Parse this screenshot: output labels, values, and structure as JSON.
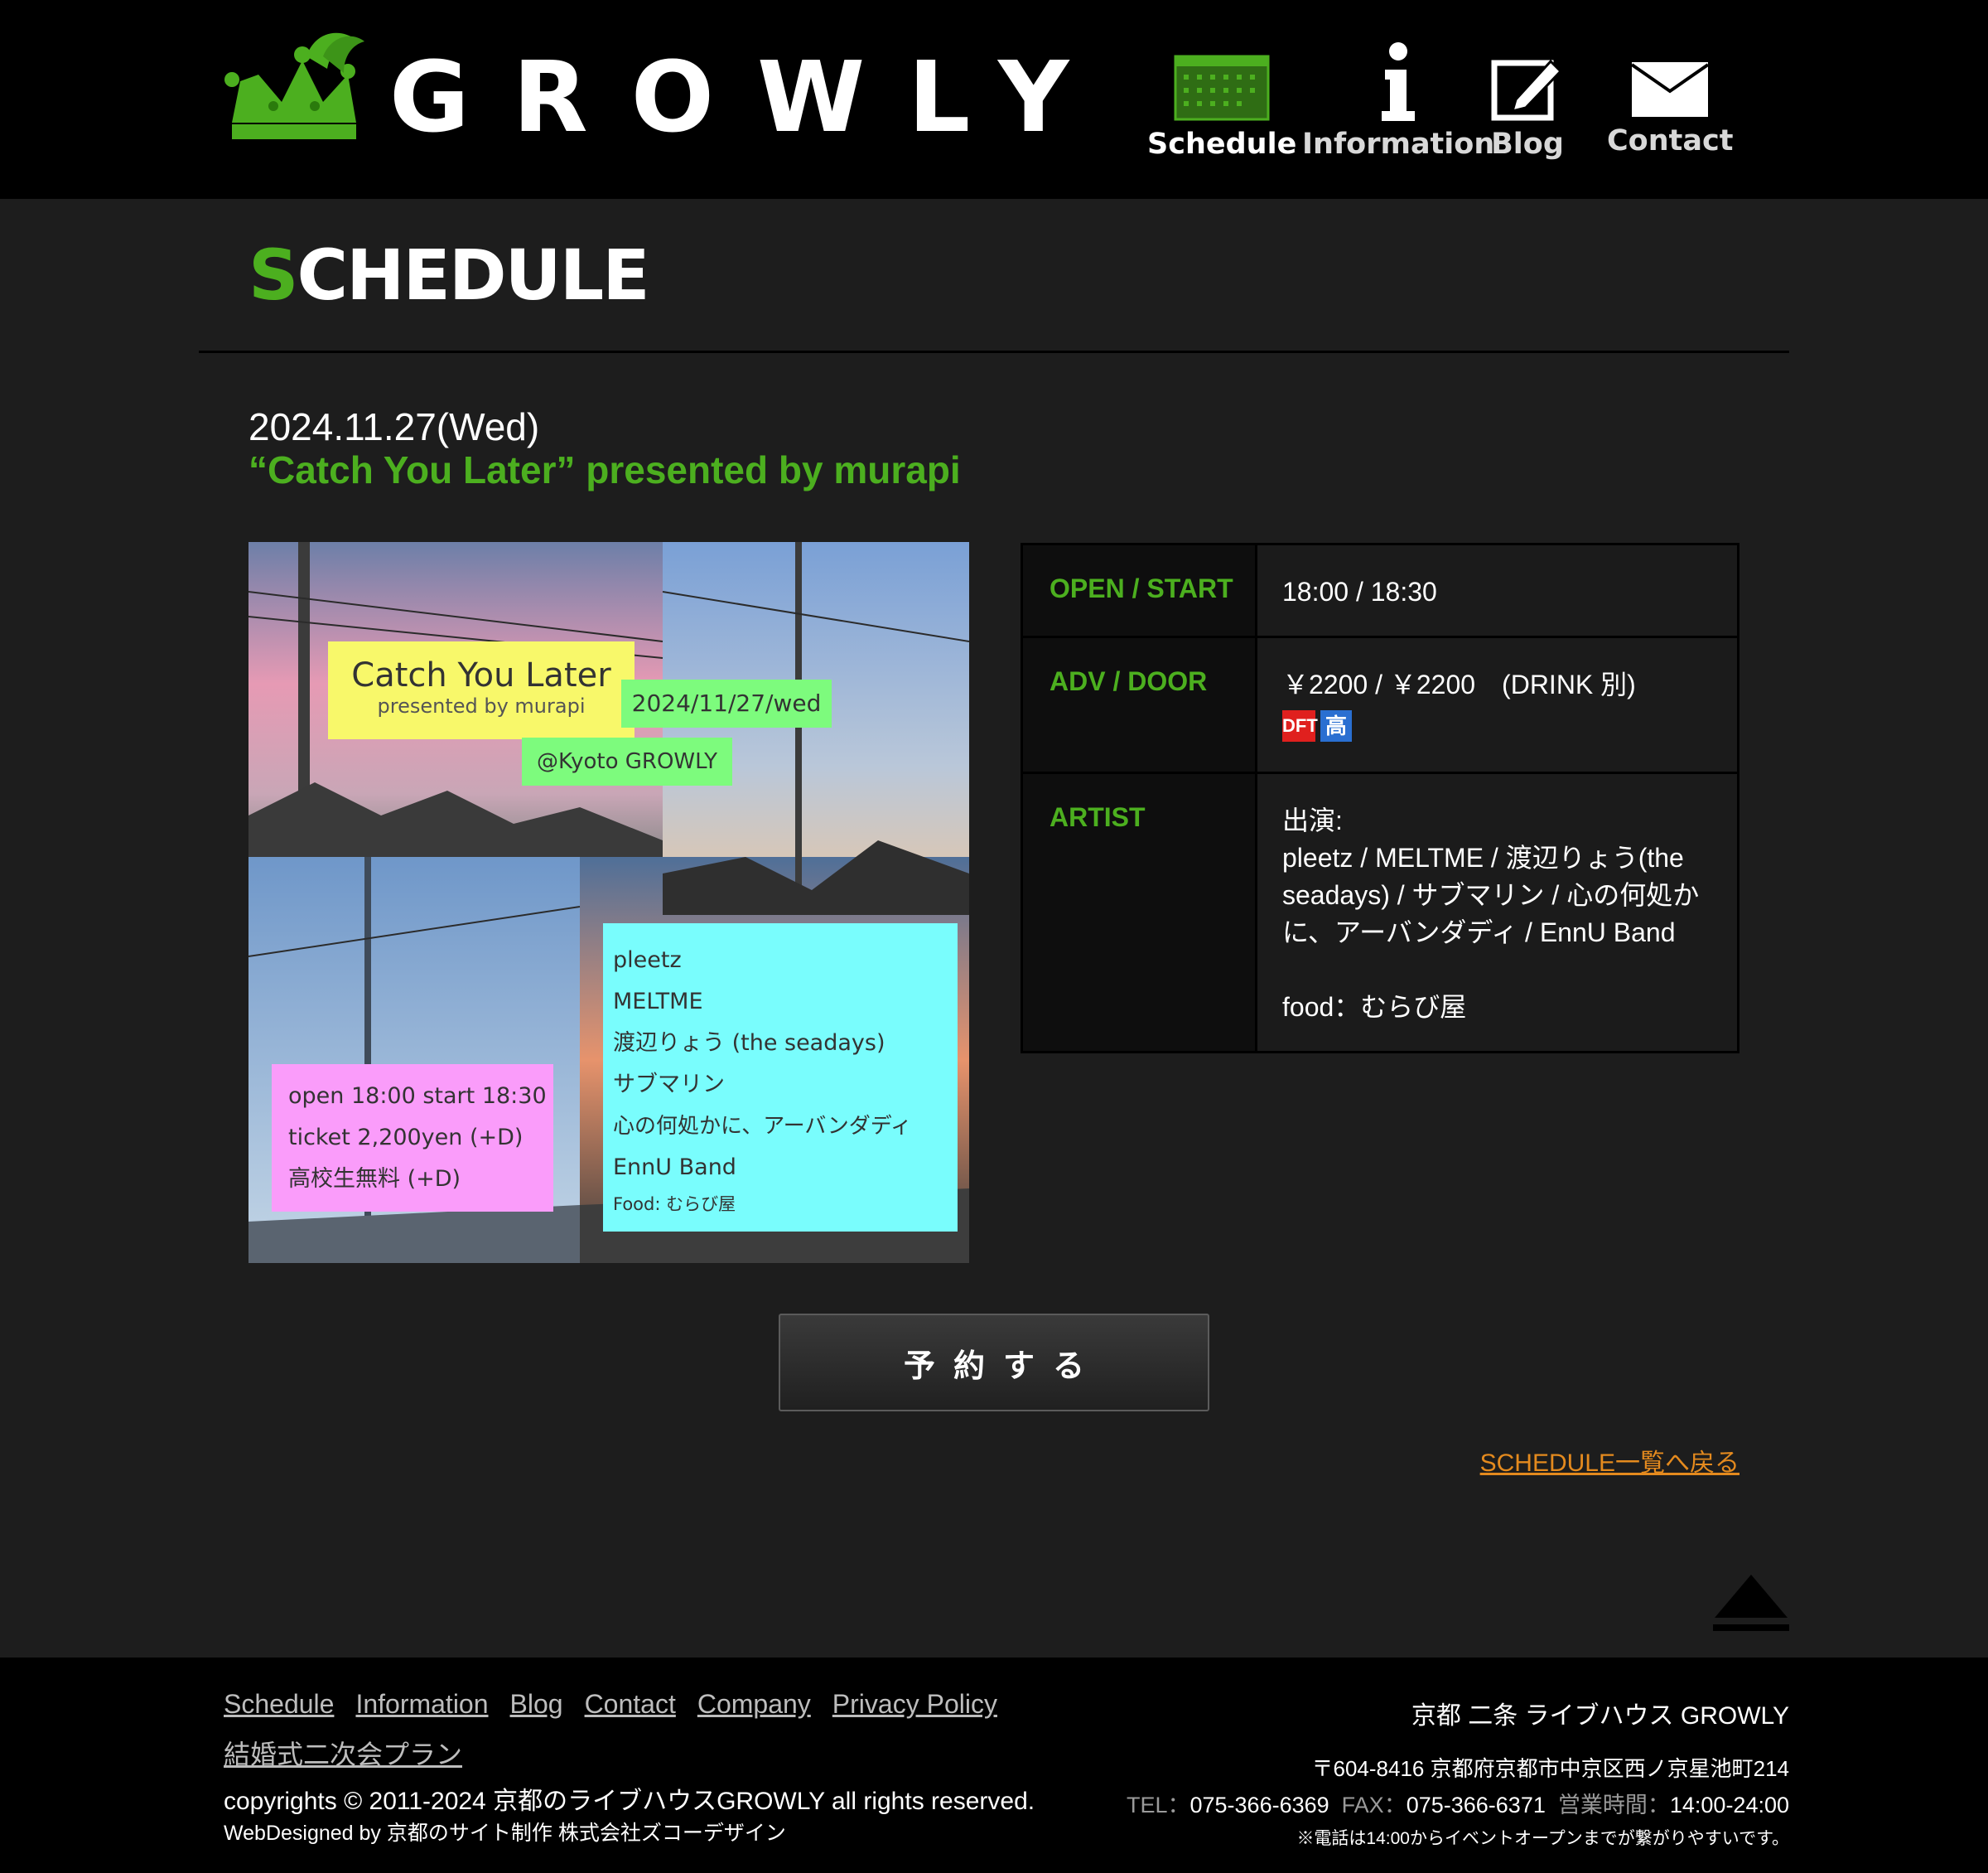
{
  "header": {
    "logo_text": "GROWLY",
    "nav": [
      {
        "label": "Schedule",
        "icon": "calendar-icon"
      },
      {
        "label": "Information",
        "icon": "info-icon"
      },
      {
        "label": "Blog",
        "icon": "pencil-edit-icon"
      },
      {
        "label": "Contact",
        "icon": "envelope-icon"
      }
    ]
  },
  "page": {
    "heading_first": "S",
    "heading_rest": "CHEDULE"
  },
  "event": {
    "date": "2024.11.27(Wed)",
    "title": "“Catch You Later” presented by murapi",
    "flyer": {
      "title": "Catch You Later",
      "subtitle": "presented by murapi",
      "date": "2024/11/27/wed",
      "venue": "@Kyoto GROWLY",
      "lineup": [
        "pleetz",
        "MELTME",
        "渡辺りょう (the seadays)",
        "サブマリン",
        "心の何処かに、アーバンダディ",
        "EnnU Band",
        "Food: むらび屋"
      ],
      "info": [
        "open 18:00  start 18:30",
        "ticket  2,200yen (+D)",
        "高校生無料 (+D)"
      ]
    },
    "table": [
      {
        "key": "OPEN / START",
        "value": "18:00 / 18:30"
      },
      {
        "key": "ADV / DOOR",
        "value": "￥2200 / ￥2200　(DRINK 別)",
        "badges": [
          "DFT",
          "高"
        ]
      },
      {
        "key": "ARTIST",
        "lines": [
          "出演:",
          "pleetz / MELTME / 渡辺りょう(the",
          "seadays) / サブマリン / 心の何処か",
          "に、アーバンダディ / EnnU Band",
          "",
          "food：むらび屋"
        ]
      }
    ],
    "reserve_label": "予約する",
    "back_link": "SCHEDULE一覧へ戻る"
  },
  "colors": {
    "accent_green": "#4caf1f",
    "link_orange": "#e48a1e"
  },
  "footer": {
    "links": [
      "Schedule",
      "Information",
      "Blog",
      "Contact",
      "Company",
      "Privacy Policy"
    ],
    "links2": [
      "結婚式二次会プラン"
    ],
    "copyright": "copyrights © 2011-2024 京都のライブハウスGROWLY all rights reserved.",
    "webdesign": "WebDesigned by 京都のサイト制作 株式会社ズコーデザイン",
    "venue_name": "京都 二条 ライブハウス GROWLY",
    "address": "〒604-8416 京都府京都市中京区西ノ京星池町214",
    "tel_label": "TEL：",
    "tel": "075-366-6369",
    "fax_label": "FAX：",
    "fax": "075-366-6371",
    "hours_label": "営業時間：",
    "hours": "14:00-24:00",
    "note": "※電話は14:00からイベントオープンまでが繋がりやすいです。"
  }
}
